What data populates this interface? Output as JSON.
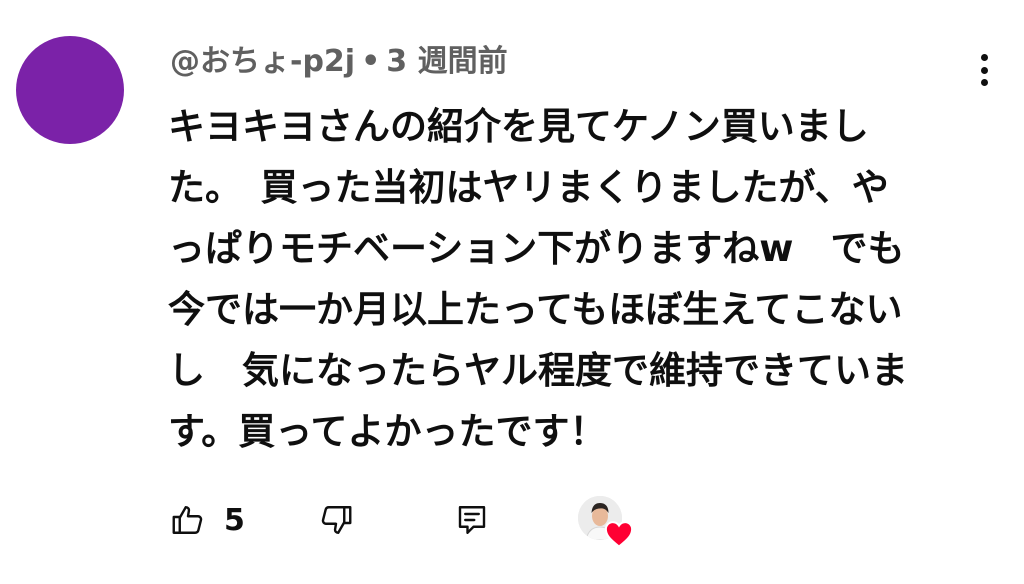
{
  "comment": {
    "author": "@おちょ-p2j",
    "separator": "•",
    "time_ago": "3 週間前",
    "body_lines": [
      "キヨキヨさんの紹介を見てケノン買いまし",
      "た。　買った当初はヤリまくりましたが、や",
      "っぱりモチベーション下がりますねw　でも",
      "今では一か月以上たってもほぼ生えてこない",
      "し　気になったらヤル程度で維持できていま",
      "す。買ってよかったです！"
    ],
    "like_count": "5"
  },
  "icons": {
    "avatar": "avatar",
    "menu": "more-vertical-icon",
    "like": "thumbs-up-icon",
    "dislike": "thumbs-down-icon",
    "reply": "reply-icon",
    "heart": "heart-icon"
  },
  "colors": {
    "avatar_bg": "#7b22a8",
    "meta_text": "#606060",
    "body_text": "#0f0f0f",
    "heart": "#ff0033"
  }
}
